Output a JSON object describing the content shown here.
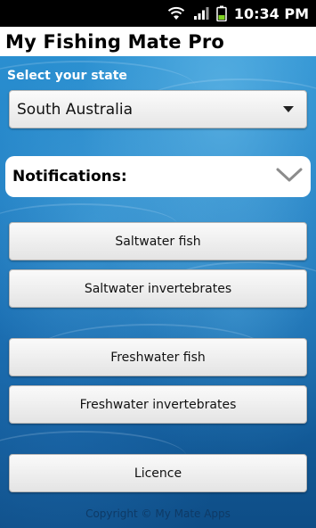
{
  "status_bar": {
    "time": "10:34 PM",
    "icons": [
      "wifi-icon",
      "signal-icon",
      "battery-icon"
    ]
  },
  "header": {
    "title": "My Fishing Mate Pro"
  },
  "state_selector": {
    "label": "Select your state",
    "selected": "South Australia"
  },
  "notifications": {
    "label": "Notifications:",
    "icon": "chevron-down-icon"
  },
  "menu": {
    "saltwater_fish": "Saltwater fish",
    "saltwater_invertebrates": "Saltwater invertebrates",
    "freshwater_fish": "Freshwater fish",
    "freshwater_invertebrates": "Freshwater invertebrates",
    "licence": "Licence"
  },
  "footer": {
    "copyright": "Copyright © My Mate Apps"
  },
  "colors": {
    "water_top": "#2a8fd0",
    "water_bottom": "#0e4d86",
    "title_bar": "#ffffff"
  }
}
